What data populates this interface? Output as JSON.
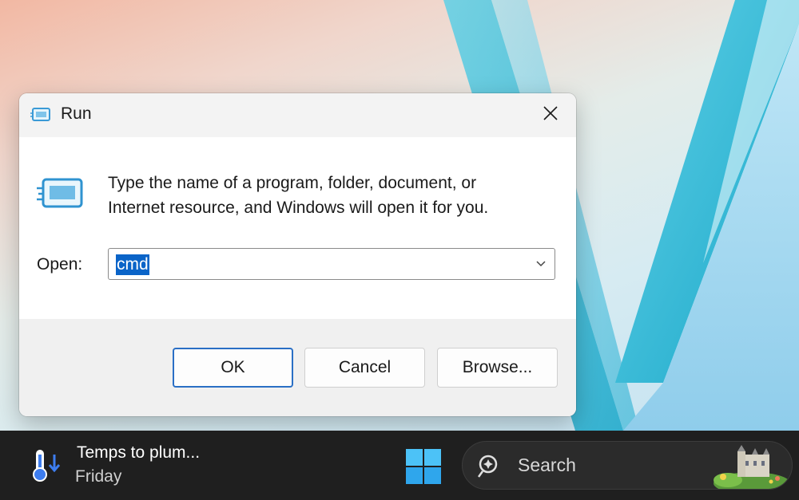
{
  "dialog": {
    "title": "Run",
    "description_line1": "Type the name of a program, folder, document, or",
    "description_line2": "Internet resource, and Windows will open it for you.",
    "open_label": "Open:",
    "open_value": "cmd",
    "buttons": {
      "ok": "OK",
      "cancel": "Cancel",
      "browse": "Browse..."
    }
  },
  "taskbar": {
    "weather_title": "Temps to plum...",
    "weather_subtitle": "Friday",
    "search_label": "Search"
  },
  "colors": {
    "accent": "#0a64c8",
    "taskbar_bg": "#1f1f1f",
    "dialog_footer": "#f0f0f0"
  },
  "icons": [
    "run-icon",
    "close-icon",
    "chevron-down-icon",
    "thermometer-icon",
    "windows-start-icon",
    "search-icon"
  ]
}
